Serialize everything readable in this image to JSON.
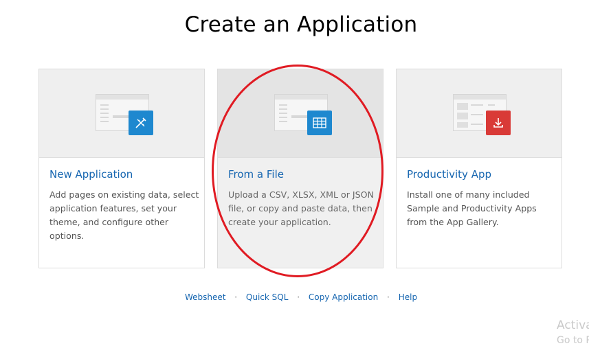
{
  "page": {
    "title": "Create an Application"
  },
  "cards": [
    {
      "title": "New Application",
      "description": "Add pages on existing data, select application features, set your theme, and configure other options.",
      "icon": "pencil-ruler-icon",
      "icon_color": "#1e88cf"
    },
    {
      "title": "From a File",
      "description": "Upload a CSV, XLSX, XML or JSON file, or copy and paste data, then create your application.",
      "icon": "table-grid-icon",
      "icon_color": "#1e88cf"
    },
    {
      "title": "Productivity App",
      "description": "Install one of many included Sample and Productivity Apps from the App Gallery.",
      "icon": "download-icon",
      "icon_color": "#d93a37"
    }
  ],
  "footer_links": {
    "websheet": "Websheet",
    "quick_sql": "Quick SQL",
    "copy_application": "Copy Application",
    "help": "Help",
    "separator": "·"
  },
  "watermark": {
    "line1": "Activa",
    "line2": "Go to P"
  },
  "annotation": {
    "color": "#e01b23"
  }
}
